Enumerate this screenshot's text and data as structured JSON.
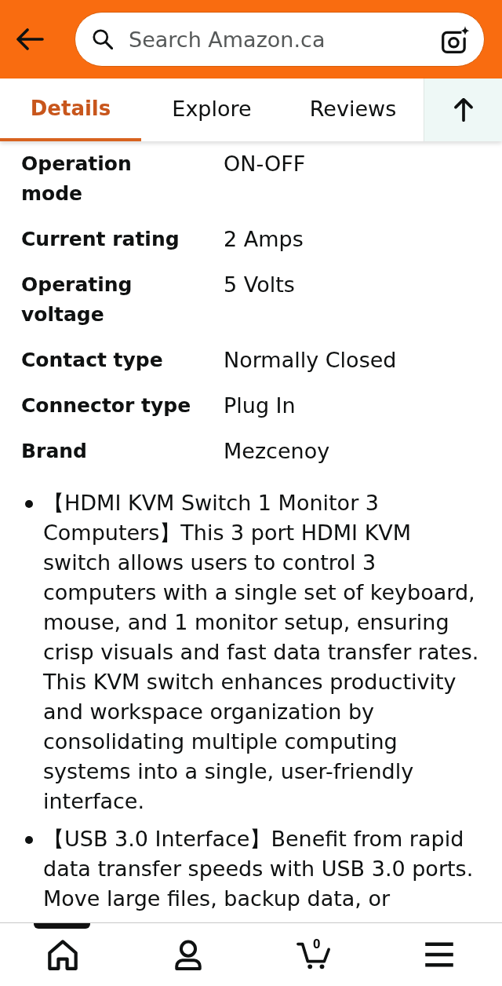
{
  "header": {
    "search": {
      "placeholder": "Search Amazon.ca"
    }
  },
  "tabs": [
    {
      "label": "Details",
      "selected": true
    },
    {
      "label": "Explore",
      "selected": false
    },
    {
      "label": "Reviews",
      "selected": false
    }
  ],
  "specs": [
    {
      "label": "Operation mode",
      "value": "ON-OFF"
    },
    {
      "label": "Current rating",
      "value": "2 Amps"
    },
    {
      "label": "Operating voltage",
      "value": "5 Volts"
    },
    {
      "label": "Contact type",
      "value": "Normally Closed"
    },
    {
      "label": "Connector type",
      "value": "Plug In"
    },
    {
      "label": "Brand",
      "value": "Mezcenoy"
    }
  ],
  "bullets": [
    "【HDMI KVM Switch 1 Monitor 3 Computers】This 3 port HDMI KVM switch allows users to control 3 computers with a single set of keyboard, mouse, and 1 monitor setup, ensuring crisp visuals and fast data transfer rates. This KVM switch enhances productivity and workspace organization by consolidating multiple computing systems into a single, user-friendly interface.",
    "【USB 3.0 Interface】Benefit from rapid data transfer speeds with USB 3.0 ports. Move large files, backup data, or"
  ],
  "bottom_nav": [
    {
      "kind": "home",
      "selected": true
    },
    {
      "kind": "account",
      "selected": false
    },
    {
      "kind": "cart",
      "selected": false,
      "count": "0"
    },
    {
      "kind": "menu",
      "selected": false
    }
  ]
}
